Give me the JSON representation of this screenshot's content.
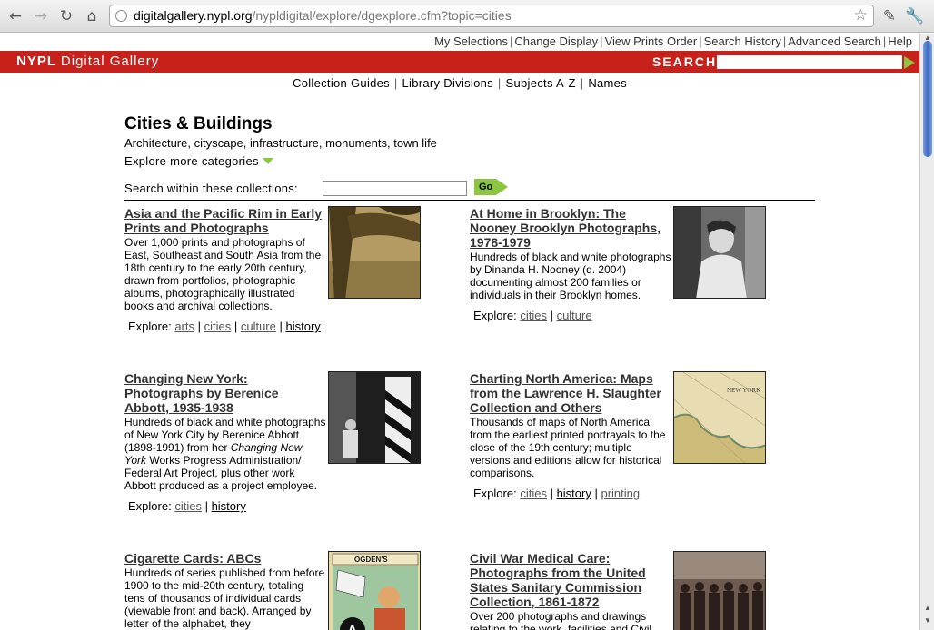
{
  "browser": {
    "url_host": "digitalgallery.nypl.org",
    "url_path": "/nypldigital/explore/dgexplore.cfm?topic=cities"
  },
  "util_nav": [
    "My Selections",
    "Change Display",
    "View Prints Order",
    "Search History",
    "Advanced Search",
    "Help"
  ],
  "header": {
    "logo_a": "NYPL",
    "logo_b": "Digital Gallery",
    "search_label": "SEARCH"
  },
  "subnav": [
    "Collection Guides",
    "Library Divisions",
    "Subjects A-Z",
    "Names"
  ],
  "page": {
    "title": "Cities & Buildings",
    "tagline": "Architecture, cityscape, infrastructure, monuments, town life",
    "more": "Explore more categories",
    "within_label": "Search within these collections:",
    "go": "Go"
  },
  "explore_label": "Explore:",
  "collections": [
    {
      "title": "Asia and the Pacific Rim in Early Prints and Photographs",
      "desc": "Over 1,000 prints and photographs of East, Southeast and South Asia from the 18th century to the early 20th century, drawn from portfolios, photographic albums, photographically illustrated books and archival collections.",
      "tags": [
        "arts",
        "cities",
        "culture",
        "history"
      ]
    },
    {
      "title": "At Home in Brooklyn: The Nooney Brooklyn Photographs, 1978-1979",
      "desc": "Hundreds of black and white photographs by Dinanda H. Nooney (d. 2004) documenting almost 200 families or individuals in their Brooklyn homes.",
      "tags": [
        "cities",
        "culture"
      ]
    },
    {
      "title": "Changing New York: Photographs by Berenice Abbott, 1935-1938",
      "desc_a": "Hundreds of black and white photographs of New York City by Berenice Abbott (1898-1991) from her ",
      "desc_em": "Changing New York",
      "desc_b": " Works Progress Administration/ Federal Art Project, plus other work Abbott produced as a project employee.",
      "tags": [
        "cities",
        "history"
      ]
    },
    {
      "title": "Charting North America: Maps from the Lawrence H. Slaughter Collection and Others",
      "desc": "Thousands of maps of North America from the earliest printed portrayals to the close of the 19th century; multiple versions and editions allow for historical comparisons.",
      "tags": [
        "cities",
        "history",
        "printing"
      ]
    },
    {
      "title": "Cigarette Cards: ABCs",
      "desc": "Hundreds of series published from before 1900 to the mid-20th century, totaling tens of thousands of individual cards (viewable front and back). Arranged by letter of the alphabet, they"
    },
    {
      "title": "Civil War Medical Care: Photographs from the United States Sanitary Commission Collection, 1861-1872",
      "desc": "Over 200 photographs and drawings relating to the work, facilities and Civil"
    }
  ],
  "thumb_text": {
    "ogden": "OGDEN'S",
    "letter": "A",
    "map": "NEW YORK"
  }
}
